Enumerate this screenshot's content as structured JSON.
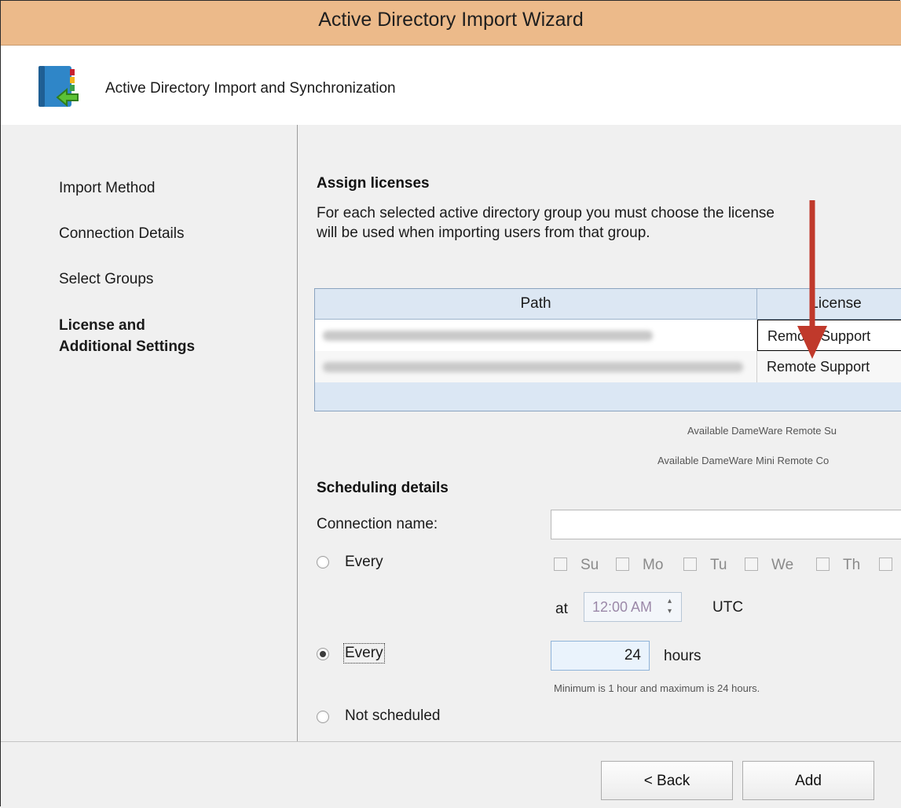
{
  "window": {
    "title": "Active Directory Import Wizard"
  },
  "header": {
    "subtitle": "Active Directory Import and Synchronization"
  },
  "steps": [
    {
      "label": "Import Method"
    },
    {
      "label": "Connection Details"
    },
    {
      "label": "Select Groups"
    },
    {
      "label": "License and\nAdditional Settings",
      "line1": "License and",
      "line2": "Additional Settings",
      "active": true
    }
  ],
  "licenses": {
    "heading": "Assign licenses",
    "description_line1": "For each selected active directory group you must choose the license",
    "description_line2": "will be used when importing users from that group.",
    "columns": {
      "path": "Path",
      "license": "License"
    },
    "rows": [
      {
        "license": "Remote Support"
      },
      {
        "license": "Remote Support"
      }
    ],
    "available1": "Available DameWare Remote Su",
    "available2": "Available DameWare Mini Remote Co"
  },
  "scheduling": {
    "heading": "Scheduling details",
    "connection_name_label": "Connection name:",
    "connection_name_value": "",
    "every_label": "Every",
    "days": [
      "Su",
      "Mo",
      "Tu",
      "We",
      "Th"
    ],
    "at_label": "at",
    "time_value": "12:00 AM",
    "utc_label": "UTC",
    "every_hours_label": "Every",
    "hours_value": "24",
    "hours_unit": "hours",
    "hours_hint": "Minimum is 1 hour and maximum is 24 hours.",
    "not_scheduled_label": "Not scheduled"
  },
  "footer": {
    "back_label": "< Back",
    "add_label": "Add"
  },
  "colors": {
    "titlebar": "#ecba8a",
    "arrow": "#c0392b",
    "grid_header": "#dce7f3"
  }
}
